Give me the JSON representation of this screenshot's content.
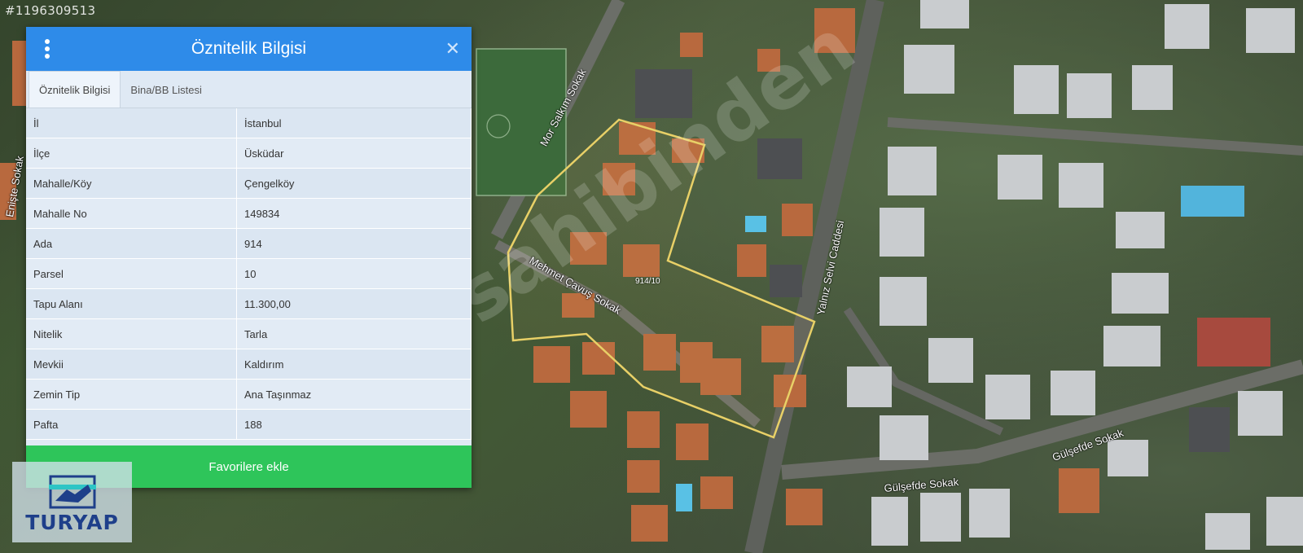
{
  "map": {
    "listing_watermark": "#1196309513",
    "watermark_text": "sahibinden",
    "parcel_label": "914/10",
    "streets": [
      {
        "name": "Mor Salkım Sokak"
      },
      {
        "name": "Mehmet Çavuş Sokak"
      },
      {
        "name": "Yalnız Selvi Caddesi"
      },
      {
        "name": "Gülşefde Sokak"
      },
      {
        "name": "Gülşefde Sokak"
      },
      {
        "name": "Enişte Sokak"
      }
    ]
  },
  "panel": {
    "title": "Öznitelik Bilgisi",
    "tabs": [
      {
        "label": "Öznitelik Bilgisi",
        "active": true
      },
      {
        "label": "Bina/BB Listesi",
        "active": false
      }
    ],
    "rows": [
      {
        "key": "İl",
        "value": "İstanbul"
      },
      {
        "key": "İlçe",
        "value": "Üsküdar"
      },
      {
        "key": "Mahalle/Köy",
        "value": "Çengelköy"
      },
      {
        "key": "Mahalle No",
        "value": "149834"
      },
      {
        "key": "Ada",
        "value": "914"
      },
      {
        "key": "Parsel",
        "value": "10"
      },
      {
        "key": "Tapu Alanı",
        "value": "11.300,00"
      },
      {
        "key": "Nitelik",
        "value": "Tarla"
      },
      {
        "key": "Mevkii",
        "value": "Kaldırım"
      },
      {
        "key": "Zemin Tip",
        "value": "Ana Taşınmaz"
      },
      {
        "key": "Pafta",
        "value": "188"
      }
    ],
    "favorite_button": "Favorilere ekle"
  },
  "logo": {
    "text": "TURYAP"
  },
  "colors": {
    "header": "#2e8be9",
    "button": "#2ec55a",
    "parcel_outline": "#e8d067",
    "logo_blue": "#1e3f8a"
  }
}
